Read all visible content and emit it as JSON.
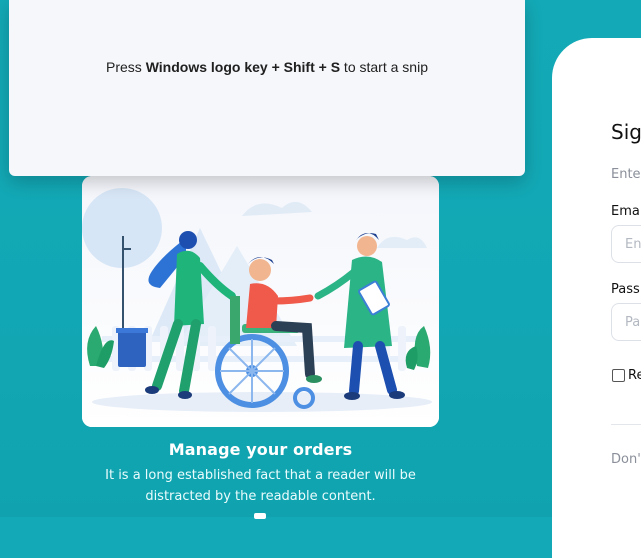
{
  "snip": {
    "prefix": "Press ",
    "keys": "Windows logo key + Shift + S",
    "suffix": " to start a snip"
  },
  "hero": {
    "title": "Manage your orders",
    "text": "It is a long established fact that a reader will be distracted by the readable content."
  },
  "signin": {
    "title": "Sig",
    "subtitle": "Enter",
    "email_label": "Ema",
    "email_placeholder": "En",
    "password_label": "Pass",
    "password_placeholder": "Pa",
    "remember_label": "Re",
    "footer_text": "Don'"
  },
  "colors": {
    "background": "#12a7b4",
    "accent_green": "#1fb57a",
    "panel": "#ffffff"
  }
}
